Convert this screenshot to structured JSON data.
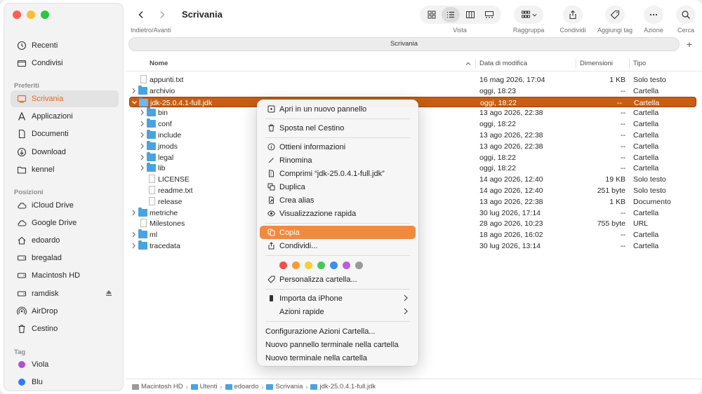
{
  "window": {
    "title": "Scrivania"
  },
  "toolbar": {
    "nav_label": "Indietro/Avanti",
    "view_label": "Vista",
    "group_label": "Raggruppa",
    "share_label": "Condividi",
    "tag_label": "Aggiungi tag",
    "action_label": "Azione",
    "search_label": "Cerca"
  },
  "tabbar": {
    "label": "Scrivania",
    "plus": "+"
  },
  "sidebar": {
    "top": [
      {
        "label": "Recenti",
        "icon": "clock-icon"
      },
      {
        "label": "Condivisi",
        "icon": "shared-folder-icon"
      }
    ],
    "favorites_title": "Preferiti",
    "favorites": [
      {
        "label": "Scrivania",
        "icon": "desktop-icon",
        "selected": true
      },
      {
        "label": "Applicazioni",
        "icon": "applications-icon"
      },
      {
        "label": "Documenti",
        "icon": "document-icon"
      },
      {
        "label": "Download",
        "icon": "download-icon"
      },
      {
        "label": "kennel",
        "icon": "folder-icon"
      }
    ],
    "locations_title": "Posizioni",
    "locations": [
      {
        "label": "iCloud Drive",
        "icon": "cloud-icon"
      },
      {
        "label": "Google Drive",
        "icon": "cloud-icon"
      },
      {
        "label": "edoardo",
        "icon": "home-icon"
      },
      {
        "label": "bregalad",
        "icon": "drive-icon"
      },
      {
        "label": "Macintosh HD",
        "icon": "drive-icon"
      },
      {
        "label": "ramdisk",
        "icon": "drive-icon"
      },
      {
        "label": "AirDrop",
        "icon": "airdrop-icon"
      },
      {
        "label": "Cestino",
        "icon": "trash-icon"
      }
    ],
    "tags_title": "Tag",
    "tags": [
      {
        "label": "Viola",
        "color": "#b04fd0"
      },
      {
        "label": "Blu",
        "color": "#2f7cf6"
      }
    ]
  },
  "columns": {
    "name": "Nome",
    "date": "Data di modifica",
    "size": "Dimensioni",
    "kind": "Tipo"
  },
  "files": [
    {
      "name": "appunti.txt",
      "date": "16 mag 2026, 17:04",
      "size": "1 KB",
      "kind": "Solo testo",
      "type": "doc",
      "level": 0,
      "chevron": ""
    },
    {
      "name": "archivio",
      "date": "oggi, 18:23",
      "size": "--",
      "kind": "Cartella",
      "type": "folder",
      "level": 0,
      "chevron": "right"
    },
    {
      "name": "jdk-25.0.4.1-full.jdk",
      "date": "oggi, 18:22",
      "size": "--",
      "kind": "Cartella",
      "type": "folder",
      "level": 0,
      "chevron": "down",
      "selected": true
    },
    {
      "name": "bin",
      "date": "13 ago 2026, 22:38",
      "size": "--",
      "kind": "Cartella",
      "type": "folder",
      "level": 1,
      "chevron": "right"
    },
    {
      "name": "conf",
      "date": "oggi, 18:22",
      "size": "--",
      "kind": "Cartella",
      "type": "folder",
      "level": 1,
      "chevron": "right"
    },
    {
      "name": "include",
      "date": "13 ago 2026, 22:38",
      "size": "--",
      "kind": "Cartella",
      "type": "folder",
      "level": 1,
      "chevron": "right"
    },
    {
      "name": "jmods",
      "date": "13 ago 2026, 22:38",
      "size": "--",
      "kind": "Cartella",
      "type": "folder",
      "level": 1,
      "chevron": "right"
    },
    {
      "name": "legal",
      "date": "oggi, 18:22",
      "size": "--",
      "kind": "Cartella",
      "type": "folder",
      "level": 1,
      "chevron": "right"
    },
    {
      "name": "lib",
      "date": "oggi, 18:22",
      "size": "--",
      "kind": "Cartella",
      "type": "folder",
      "level": 1,
      "chevron": "right"
    },
    {
      "name": "LICENSE",
      "date": "14 ago 2026, 12:40",
      "size": "19 KB",
      "kind": "Solo testo",
      "type": "doc",
      "level": 1,
      "chevron": ""
    },
    {
      "name": "readme.txt",
      "date": "14 ago 2026, 12:40",
      "size": "251 byte",
      "kind": "Solo testo",
      "type": "doc",
      "level": 1,
      "chevron": ""
    },
    {
      "name": "release",
      "date": "13 ago 2026, 22:38",
      "size": "1 KB",
      "kind": "Documento",
      "type": "doc",
      "level": 1,
      "chevron": ""
    },
    {
      "name": "metriche",
      "date": "30 lug 2026, 17:14",
      "size": "--",
      "kind": "Cartella",
      "type": "folder",
      "level": 0,
      "chevron": "right"
    },
    {
      "name": "Milestones",
      "date": "28 ago 2026, 10:23",
      "size": "755 byte",
      "kind": "URL",
      "type": "doc",
      "level": 0,
      "chevron": ""
    },
    {
      "name": "ml",
      "date": "18 ago 2026, 16:02",
      "size": "--",
      "kind": "Cartella",
      "type": "folder",
      "level": 0,
      "chevron": "right"
    },
    {
      "name": "tracedata",
      "date": "30 lug 2026, 13:14",
      "size": "--",
      "kind": "Cartella",
      "type": "folder",
      "level": 0,
      "chevron": "right"
    }
  ],
  "statusbar": {
    "path": [
      "Macintosh HD",
      "Utenti",
      "edoardo",
      "Scrivania",
      "jdk-25.0.4.1-full.jdk"
    ]
  },
  "context_menu": {
    "open_new_pane": "Apri in un nuovo pannello",
    "move_trash": "Sposta nel Cestino",
    "get_info": "Ottieni informazioni",
    "rename": "Rinomina",
    "compress": "Comprimi “jdk-25.0.4.1-full.jdk”",
    "duplicate": "Duplica",
    "make_alias": "Crea alias",
    "quick_look": "Visualizzazione rapida",
    "copy": "Copia",
    "share": "Condividi...",
    "tag_colors": [
      "#f0504c",
      "#f59a3a",
      "#f5cd3a",
      "#4cc45a",
      "#3d8ef0",
      "#b95fdc",
      "#9a9a9a"
    ],
    "customize_folder": "Personalizza cartella...",
    "import_iphone": "Importa da iPhone",
    "quick_actions": "Azioni rapide",
    "folder_actions_setup": "Configurazione Azioni Cartella...",
    "new_terminal_tab": "Nuovo pannello terminale nella cartella",
    "new_terminal": "Nuovo terminale nella cartella"
  }
}
